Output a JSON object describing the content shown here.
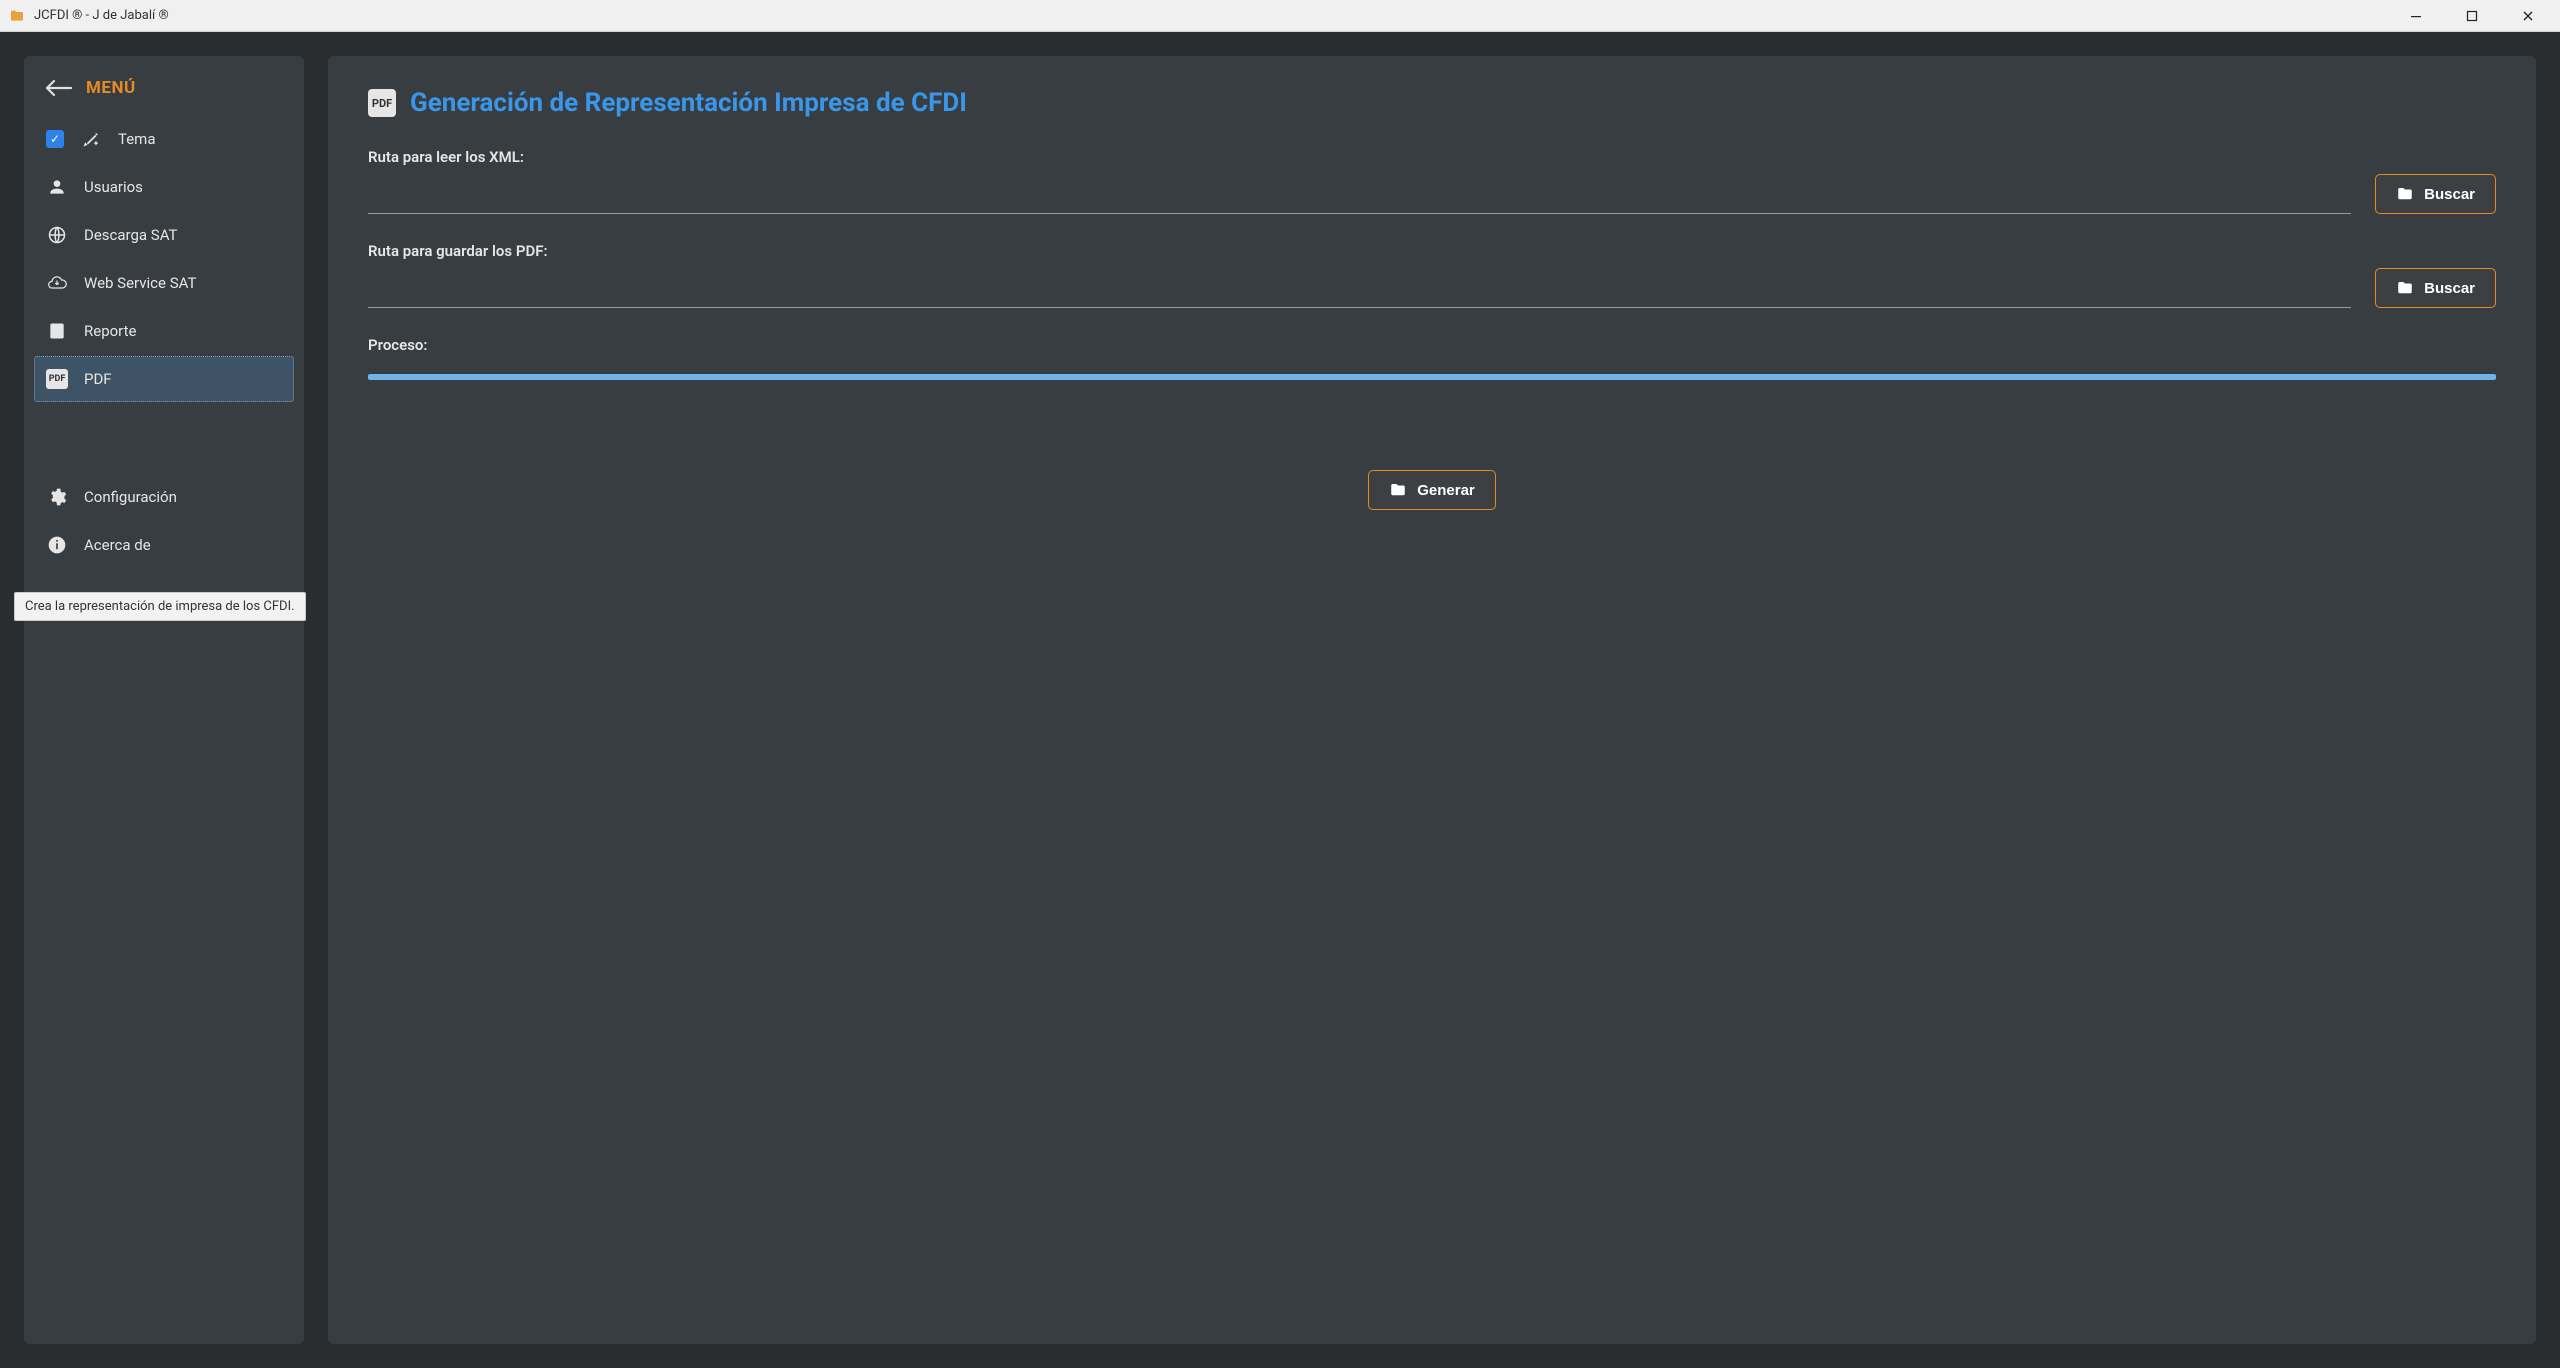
{
  "window": {
    "title": "JCFDI ®  -  J de Jabalí ®"
  },
  "sidebar": {
    "menu_label": "MENÚ",
    "items": [
      {
        "label": "Tema",
        "icon": "theme"
      },
      {
        "label": "Usuarios",
        "icon": "user"
      },
      {
        "label": "Descarga SAT",
        "icon": "globe"
      },
      {
        "label": "Web Service SAT",
        "icon": "cloud"
      },
      {
        "label": "Reporte",
        "icon": "chart"
      },
      {
        "label": "PDF",
        "icon": "pdf"
      },
      {
        "label": "Configuración",
        "icon": "gear"
      },
      {
        "label": "Acerca de",
        "icon": "info"
      }
    ],
    "tooltip": "Crea la representación de impresa de los CFDI."
  },
  "page": {
    "title": "Generación de Representación Impresa de CFDI",
    "xml_path_label": "Ruta para leer los XML:",
    "xml_path_value": "",
    "pdf_path_label": "Ruta para guardar los PDF:",
    "pdf_path_value": "",
    "browse_label": "Buscar",
    "process_label": "Proceso:",
    "generate_label": "Generar"
  }
}
